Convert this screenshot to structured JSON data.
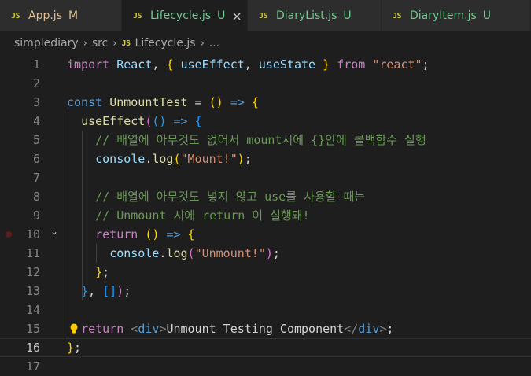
{
  "tabs": [
    {
      "name": "App.js",
      "status": "M",
      "name_color": "#e2c08d",
      "status_color": "#e2c08d",
      "active": false,
      "icon": "js-icon"
    },
    {
      "name": "Lifecycle.js",
      "status": "U",
      "name_color": "#73c991",
      "status_color": "#73c991",
      "active": true,
      "icon": "js-icon",
      "close": "×"
    },
    {
      "name": "DiaryList.js",
      "status": "U",
      "name_color": "#73c991",
      "status_color": "#73c991",
      "active": false,
      "icon": "js-icon"
    },
    {
      "name": "DiaryItem.js",
      "status": "U",
      "name_color": "#73c991",
      "status_color": "#73c991",
      "active": false,
      "icon": "js-icon"
    }
  ],
  "icon_text": "JS",
  "breadcrumb": {
    "folder1": "simplediary",
    "folder2": "src",
    "file": "Lifecycle.js",
    "more": "..."
  },
  "editor": {
    "active_line": 16,
    "lines": [
      {
        "n": "1",
        "t": [
          [
            "kw",
            "import"
          ],
          [
            "tx",
            " "
          ],
          [
            "id",
            "React"
          ],
          [
            "tx",
            ", "
          ],
          [
            "b1",
            "{"
          ],
          [
            "tx",
            " "
          ],
          [
            "id",
            "useEffect"
          ],
          [
            "tx",
            ", "
          ],
          [
            "id",
            "useState"
          ],
          [
            "tx",
            " "
          ],
          [
            "b1",
            "}"
          ],
          [
            "tx",
            " "
          ],
          [
            "kw",
            "from"
          ],
          [
            "tx",
            " "
          ],
          [
            "st",
            "\"react\""
          ],
          [
            "tx",
            ";"
          ]
        ]
      },
      {
        "n": "2",
        "t": []
      },
      {
        "n": "3",
        "t": [
          [
            "kb",
            "const"
          ],
          [
            "tx",
            " "
          ],
          [
            "fn",
            "UnmountTest"
          ],
          [
            "tx",
            " = "
          ],
          [
            "b1",
            "()"
          ],
          [
            "tx",
            " "
          ],
          [
            "kb",
            "=>"
          ],
          [
            "tx",
            " "
          ],
          [
            "b1",
            "{"
          ]
        ]
      },
      {
        "n": "4",
        "t": [
          [
            "tx",
            "  "
          ],
          [
            "fn",
            "useEffect"
          ],
          [
            "b2",
            "("
          ],
          [
            "b3",
            "()"
          ],
          [
            "tx",
            " "
          ],
          [
            "kb",
            "=>"
          ],
          [
            "tx",
            " "
          ],
          [
            "b3",
            "{"
          ]
        ]
      },
      {
        "n": "5",
        "t": [
          [
            "tx",
            "    "
          ],
          [
            "cm",
            "// 배열에 아무것도 없어서 mount시에 {}안에 콜백함수 실행"
          ]
        ]
      },
      {
        "n": "6",
        "t": [
          [
            "tx",
            "    "
          ],
          [
            "id",
            "console"
          ],
          [
            "tx",
            "."
          ],
          [
            "fn",
            "log"
          ],
          [
            "b1",
            "("
          ],
          [
            "st",
            "\"Mount!\""
          ],
          [
            "b1",
            ")"
          ],
          [
            "tx",
            ";"
          ]
        ]
      },
      {
        "n": "7",
        "t": []
      },
      {
        "n": "8",
        "t": [
          [
            "tx",
            "    "
          ],
          [
            "cm",
            "// 배열에 아무것도 넣지 않고 use를 사용할 때는"
          ]
        ]
      },
      {
        "n": "9",
        "t": [
          [
            "tx",
            "    "
          ],
          [
            "cm",
            "// Unmount 시에 return 이 실행돼!"
          ]
        ]
      },
      {
        "n": "10",
        "t": [
          [
            "tx",
            "    "
          ],
          [
            "kw",
            "return"
          ],
          [
            "tx",
            " "
          ],
          [
            "b1",
            "()"
          ],
          [
            "tx",
            " "
          ],
          [
            "kb",
            "=>"
          ],
          [
            "tx",
            " "
          ],
          [
            "b1",
            "{"
          ]
        ],
        "fold": true,
        "breakpoint": true
      },
      {
        "n": "11",
        "t": [
          [
            "tx",
            "      "
          ],
          [
            "id",
            "console"
          ],
          [
            "tx",
            "."
          ],
          [
            "fn",
            "log"
          ],
          [
            "b2",
            "("
          ],
          [
            "st",
            "\"Unmount!\""
          ],
          [
            "b2",
            ")"
          ],
          [
            "tx",
            ";"
          ]
        ]
      },
      {
        "n": "12",
        "t": [
          [
            "tx",
            "    "
          ],
          [
            "b1",
            "}"
          ],
          [
            "tx",
            ";"
          ]
        ]
      },
      {
        "n": "13",
        "t": [
          [
            "tx",
            "  "
          ],
          [
            "b3",
            "}"
          ],
          [
            "tx",
            ", "
          ],
          [
            "b3",
            "[]"
          ],
          [
            "b2",
            ")"
          ],
          [
            "tx",
            ";"
          ]
        ]
      },
      {
        "n": "14",
        "t": []
      },
      {
        "n": "15",
        "t": [
          [
            "tx",
            "  "
          ],
          [
            "kw",
            "return"
          ],
          [
            "tx",
            " "
          ],
          [
            "tp",
            "<"
          ],
          [
            "tg",
            "div"
          ],
          [
            "tp",
            ">"
          ],
          [
            "tx",
            "Unmount Testing Component"
          ],
          [
            "tp",
            "</"
          ],
          [
            "tg",
            "div"
          ],
          [
            "tp",
            ">"
          ],
          [
            "tx",
            ";"
          ]
        ],
        "bulb": true
      },
      {
        "n": "16",
        "t": [
          [
            "b1",
            "}"
          ],
          [
            "tx",
            ";"
          ]
        ]
      },
      {
        "n": "17",
        "t": []
      }
    ]
  }
}
